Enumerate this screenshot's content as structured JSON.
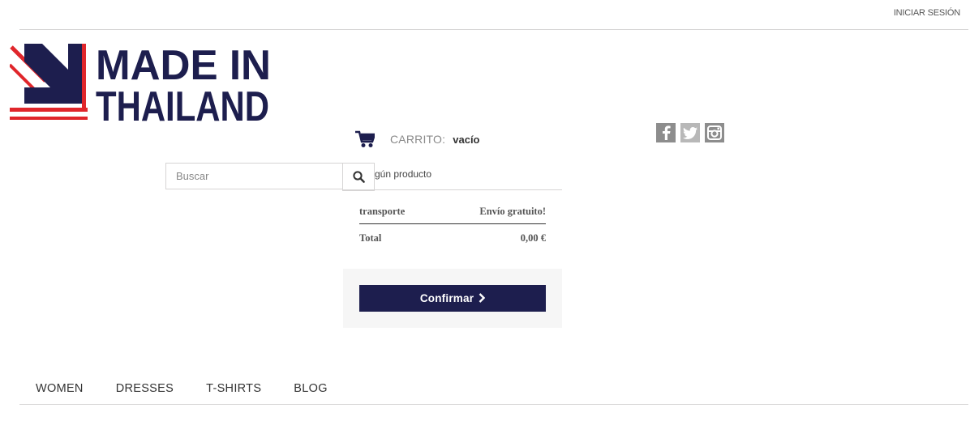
{
  "header": {
    "login_label": "INICIAR SESIÓN",
    "logo_line1": "MADE IN",
    "logo_line2": "THAILAND"
  },
  "cart": {
    "label": "CARRITO:",
    "quantity_label": "vacío",
    "empty_text": "gún producto",
    "shipping_label": "transporte",
    "shipping_value": "Envío gratuito!",
    "total_label": "Total",
    "total_value": "0,00 €",
    "checkout_label": "Confirmar"
  },
  "search": {
    "placeholder": "Buscar"
  },
  "social": [
    "facebook-icon",
    "twitter-icon",
    "instagram-icon"
  ],
  "menu": {
    "items": [
      {
        "label": "WOMEN"
      },
      {
        "label": "DRESSES"
      },
      {
        "label": "T-SHIRTS"
      },
      {
        "label": "BLOG"
      }
    ]
  },
  "colors": {
    "brand_navy": "#1d1e4e",
    "brand_red": "#e0262b"
  }
}
